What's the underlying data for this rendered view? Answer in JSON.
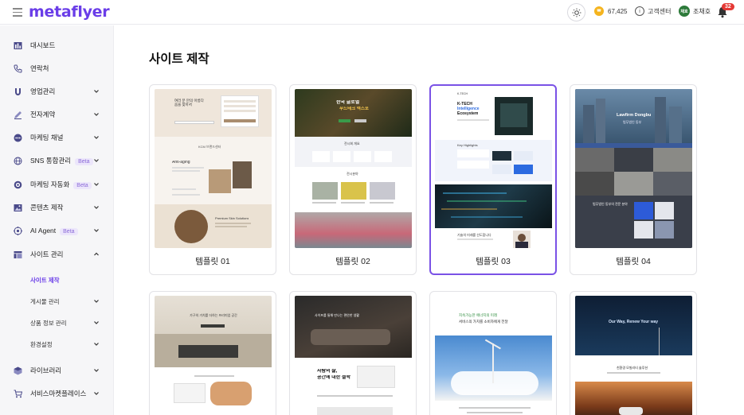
{
  "header": {
    "logo": "metaflyer",
    "points": "67,425",
    "coin_label": "₩",
    "help_label": "고객센터",
    "user_initials": "채호",
    "user_name": "조채호",
    "notification_count": "32"
  },
  "sidebar": {
    "items": [
      {
        "label": "대시보드",
        "icon": "dashboard-icon"
      },
      {
        "label": "연락처",
        "icon": "phone-icon"
      },
      {
        "label": "영업관리",
        "icon": "magnet-icon"
      },
      {
        "label": "전자계약",
        "icon": "pen-icon"
      },
      {
        "label": "마케팅 채널",
        "icon": "chat-dots-icon"
      },
      {
        "label": "SNS 통합관리",
        "icon": "globe-icon",
        "badge": "Beta"
      },
      {
        "label": "마케팅 자동화",
        "icon": "target-icon",
        "badge": "Beta"
      },
      {
        "label": "콘텐츠 제작",
        "icon": "image-icon"
      },
      {
        "label": "AI Agent",
        "icon": "ai-icon",
        "badge": "Beta"
      },
      {
        "label": "사이트 관리",
        "icon": "layout-icon"
      }
    ],
    "sub_items": [
      {
        "label": "사이트 제작"
      },
      {
        "label": "게시물 관리"
      },
      {
        "label": "상품 정보 관리"
      },
      {
        "label": "환경설정"
      }
    ],
    "bottom_items": [
      {
        "label": "라이브러리",
        "icon": "cube-icon"
      },
      {
        "label": "서비스마켓플레이스",
        "icon": "cart-icon"
      }
    ]
  },
  "main": {
    "title": "사이트 제작",
    "templates": [
      {
        "label": "템플릿 01"
      },
      {
        "label": "템플릿 02"
      },
      {
        "label": "템플릿 03"
      },
      {
        "label": "템플릿 04"
      }
    ]
  },
  "thumbnails": {
    "t1": {
      "hero": "여러 분 만의 아름다움을 찾아서",
      "section": "KCM 브랜드센터",
      "sub": "Anti-aging",
      "feature": "Premium Skin Solutions"
    },
    "t2": {
      "hero": "한국 글로벌",
      "hero2": "푸드테크 엑스포",
      "section": "전시회 개요",
      "section2": "전시분야"
    },
    "t3": {
      "brand": "K-TECH",
      "hero1": "K-TECH",
      "hero2": "Intelligence",
      "hero3": "Ecosystem",
      "section": "Key Highlights",
      "quote": "기술의 미래를 선도합니다"
    },
    "t4": {
      "hero": "Lawfirm Dongbu",
      "sub": "법무법인 동부",
      "section": "법무법인 동부의 전문 분야"
    },
    "t5": {
      "hero": "가구의 가치를 더하는 프리미엄 공간"
    },
    "t6": {
      "hero": "사람의 삶,",
      "hero2": "공간에 대한 철학"
    },
    "t7": {
      "hero": "지속가능한 에너지의 미래",
      "sub": "서비스의 가치를 소비자에게 전달"
    },
    "t8": {
      "hero": "Our Way, Renew Your way",
      "sub": "친환경 모빌리티 솔루션"
    }
  }
}
